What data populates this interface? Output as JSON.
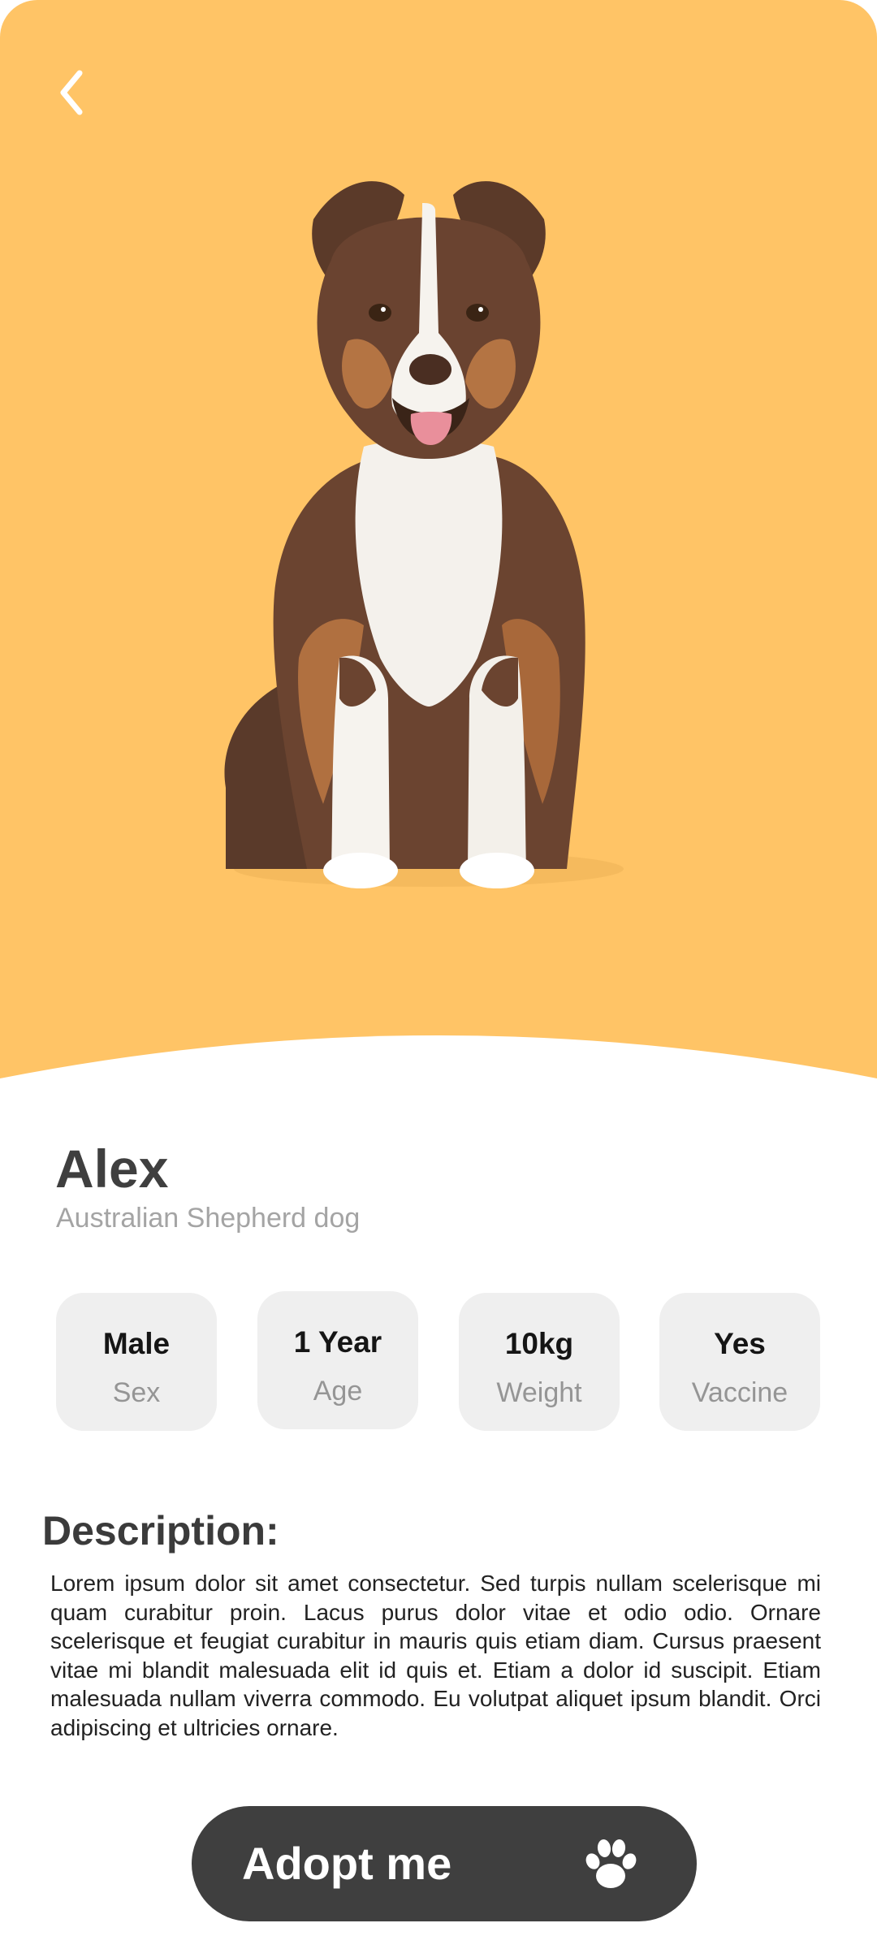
{
  "theme": {
    "accent": "#ffc466",
    "button_bg": "#3f3f3f",
    "card_bg": "#efefef"
  },
  "header": {
    "back_icon": "chevron-left-icon"
  },
  "pet": {
    "image_alt": "dog-photo",
    "name": "Alex",
    "breed": "Australian Shepherd dog"
  },
  "stats": [
    {
      "value": "Male",
      "label": "Sex"
    },
    {
      "value": "1 Year",
      "label": "Age"
    },
    {
      "value": "10kg",
      "label": "Weight"
    },
    {
      "value": "Yes",
      "label": "Vaccine"
    }
  ],
  "description": {
    "title": "Description:",
    "text": "Lorem ipsum dolor sit amet consectetur. Sed turpis nullam scelerisque mi quam curabitur proin. Lacus purus dolor vitae et odio odio. Ornare scelerisque et feugiat curabitur in mauris quis etiam diam. Cursus praesent vitae mi blandit malesuada elit id quis et. Etiam a dolor id suscipit. Etiam malesuada nullam viverra commodo. Eu volutpat aliquet ipsum blandit. Orci adipiscing et ultricies ornare."
  },
  "cta": {
    "label": "Adopt me",
    "icon": "paw-icon"
  }
}
